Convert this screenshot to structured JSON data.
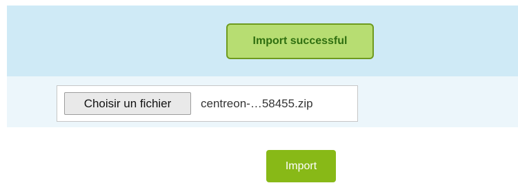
{
  "status": {
    "message": "Import successful",
    "color": "#b7dd72",
    "border_color": "#6e9a1e",
    "text_color": "#2f6f10"
  },
  "file_input": {
    "button_label": "Choisir un fichier",
    "file_name": "centreon-…58455.zip"
  },
  "actions": {
    "import_label": "Import",
    "import_color": "#88b917"
  },
  "theme": {
    "banner_color": "#cfeaf6",
    "row_color": "#ecf6fb"
  }
}
